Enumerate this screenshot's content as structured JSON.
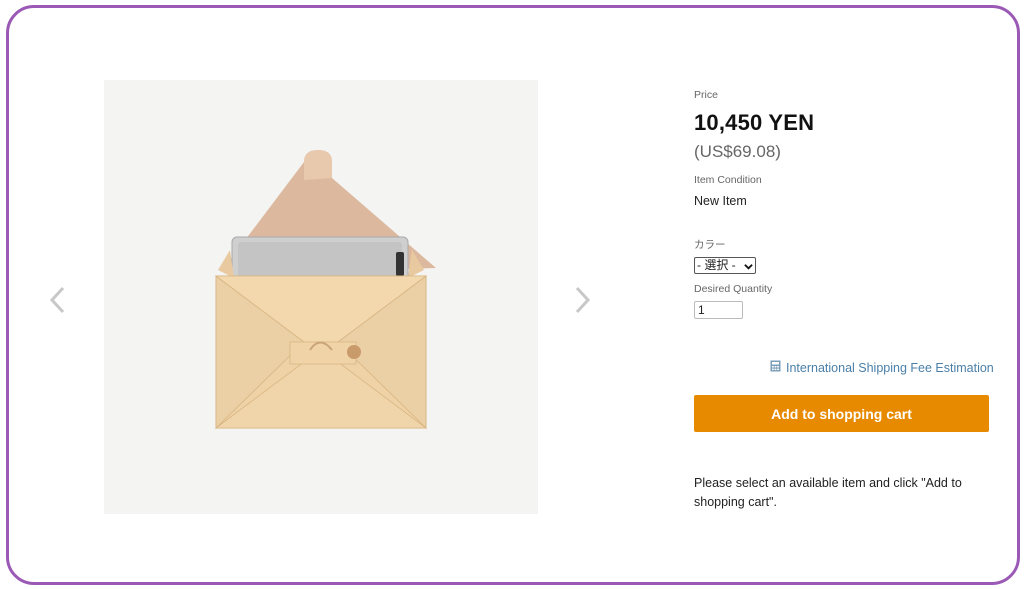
{
  "colors": {
    "frame": "#9b59b6",
    "accent": "#e88a00",
    "link": "#4a7fa8"
  },
  "carousel": {
    "prev_icon": "chevron-left-icon",
    "next_icon": "chevron-right-icon"
  },
  "price": {
    "label": "Price",
    "yen": "10,450 YEN",
    "usd": "(US$69.08)"
  },
  "condition": {
    "label": "Item Condition",
    "value": "New Item"
  },
  "color_option": {
    "label": "カラー",
    "selected": "- 選択 -"
  },
  "quantity": {
    "label": "Desired Quantity",
    "value": "1"
  },
  "shipping": {
    "icon": "calculator-icon",
    "label": "International Shipping Fee Estimation"
  },
  "cart": {
    "button_label": "Add to shopping cart"
  },
  "note": "Please select an available item and click \"Add to shopping cart\"."
}
